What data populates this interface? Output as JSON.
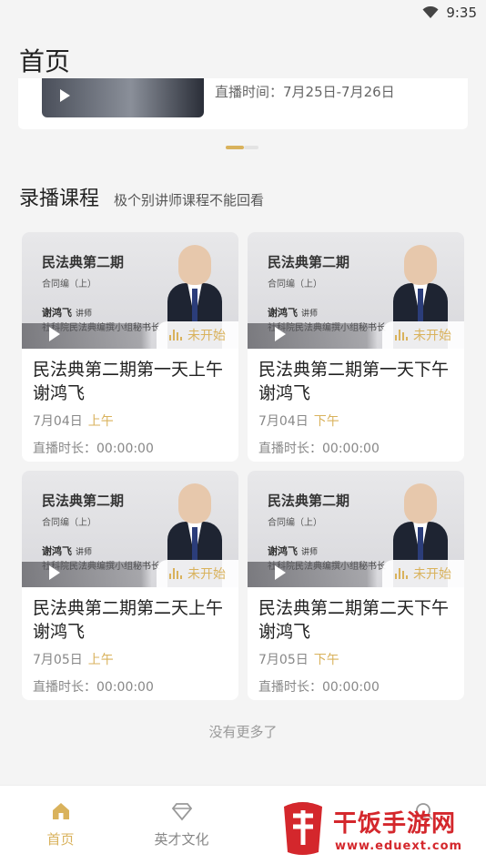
{
  "status_bar": {
    "time": "9:35"
  },
  "header": {
    "title": "首页"
  },
  "banner": {
    "text": "直播时间：7月25日-7月26日"
  },
  "section": {
    "title": "录播课程",
    "subtitle": "极个别讲师课程不能回看"
  },
  "courses": [
    {
      "thumb_title": "民法典第二期",
      "thumb_sub": "合同编（上）",
      "lecturer": "谢鸿飞",
      "lecturer_role": "讲师",
      "org": "社科院民法典编撰小组秘书长",
      "status": "未开始",
      "title": "民法典第二期第一天上午谢鸿飞",
      "date": "7月04日",
      "period": "上午",
      "duration": "直播时长：00:00:00"
    },
    {
      "thumb_title": "民法典第二期",
      "thumb_sub": "合同编（上）",
      "lecturer": "谢鸿飞",
      "lecturer_role": "讲师",
      "org": "社科院民法典编撰小组秘书长",
      "status": "未开始",
      "title": "民法典第二期第一天下午谢鸿飞",
      "date": "7月04日",
      "period": "下午",
      "duration": "直播时长：00:00:00"
    },
    {
      "thumb_title": "民法典第二期",
      "thumb_sub": "合同编（上）",
      "lecturer": "谢鸿飞",
      "lecturer_role": "讲师",
      "org": "社科院民法典编撰小组秘书长",
      "status": "未开始",
      "title": "民法典第二期第二天上午谢鸿飞",
      "date": "7月05日",
      "period": "上午",
      "duration": "直播时长：00:00:00"
    },
    {
      "thumb_title": "民法典第二期",
      "thumb_sub": "合同编（上）",
      "lecturer": "谢鸿飞",
      "lecturer_role": "讲师",
      "org": "社科院民法典编撰小组秘书长",
      "status": "未开始",
      "title": "民法典第二期第二天下午谢鸿飞",
      "date": "7月05日",
      "period": "下午",
      "duration": "直播时长：00:00:00"
    }
  ],
  "footer_note": "没有更多了",
  "tabs": [
    {
      "label": "首页",
      "icon": "home-icon",
      "active": true
    },
    {
      "label": "英才文化",
      "icon": "diamond-icon",
      "active": false
    },
    {
      "label": "",
      "icon": "document-icon",
      "active": false
    },
    {
      "label": "",
      "icon": "search-icon",
      "active": false
    }
  ],
  "watermark": {
    "name": "干饭手游网",
    "url": "www.eduext.com"
  },
  "colors": {
    "accent": "#d9b25c",
    "background": "#f4f4f4",
    "watermark": "#d4272c"
  }
}
